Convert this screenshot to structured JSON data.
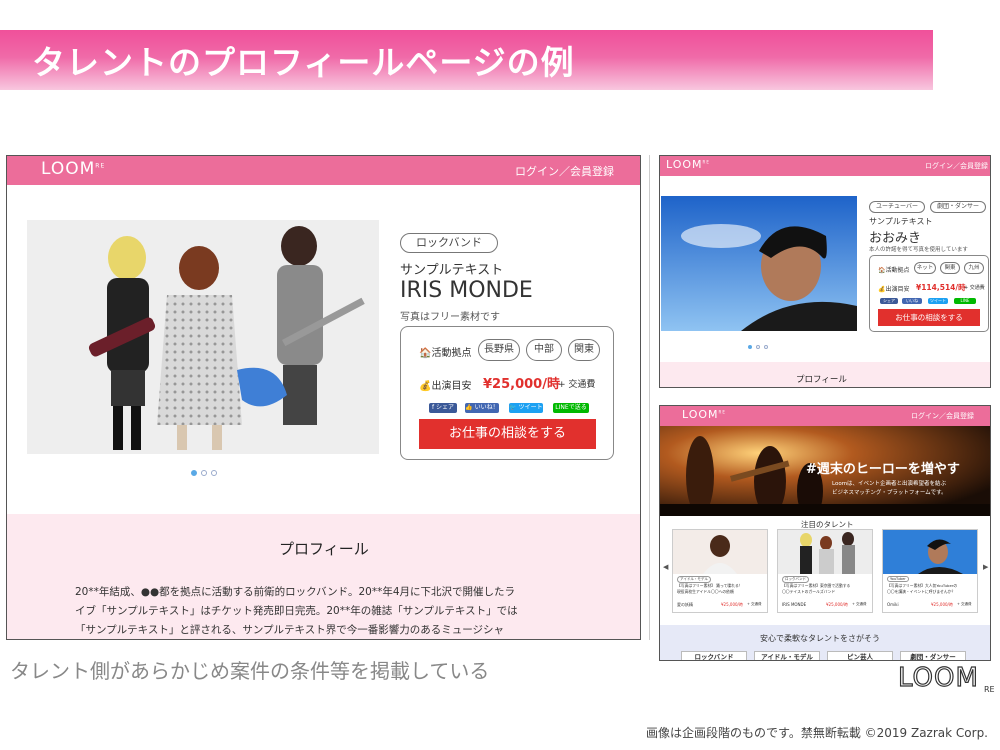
{
  "slide_title": "タレントのプロフィールページの例",
  "caption": "タレント側があらかじめ案件の条件等を掲載している",
  "copyright": "画像は企画段階のものです。禁無断転載 ©2019 Zazrak Corp.",
  "logo_text": "LOOM",
  "logo_sup": "RE",
  "main_page": {
    "login": "ログイン／会員登録",
    "category": "ロックバンド",
    "sample": "サンプルテキスト",
    "name": "IRIS MONDE",
    "photo_note": "写真はフリー素材です",
    "area_label": "🏠活動拠点",
    "areas": [
      "長野県",
      "中部",
      "関東"
    ],
    "fee_label": "💰出演目安",
    "fee": "¥25,000/時",
    "fee_suffix": "+ 交通費",
    "share": [
      "f シェア",
      "👍 いいね！",
      "🐦 ツイート",
      "LINEで送る"
    ],
    "cta": "お仕事の相談をする",
    "profile_heading": "プロフィール",
    "profile_lines": [
      "20**年結成、●●都を拠点に活動する前衛的ロックバンド。20**年4月に下北沢で開催したラ",
      "イブ「サンプルテキスト」はチケット発売即日完売。20**年の雑誌「サンプルテキスト」では",
      "「サンプルテキスト」と評される、サンプルテキスト界で今一番影響力のあるミュージシャ"
    ]
  },
  "mini_profile": {
    "login": "ログイン／会員登録",
    "categories": [
      "ユーチューバー",
      "劇団・ダンサー"
    ],
    "sample": "サンプルテキスト",
    "name": "おおみき",
    "note": "本人の許諾を得て写真を使用しています",
    "area_label": "🏠活動拠点",
    "areas": [
      "ネット",
      "関東",
      "九州"
    ],
    "fee_label": "💰出演目安",
    "fee": "¥114,514/時",
    "fee_suffix": "+ 交通費",
    "share": [
      "シェア",
      "いいね",
      "ツイート",
      "LINE"
    ],
    "cta": "お仕事の相談をする",
    "profile_heading": "プロフィール"
  },
  "mini_top": {
    "login": "ログイン／会員登録",
    "hero_title": "#週末のヒーローを増やす",
    "hero_sub_1": "Loomは、イベント企画者と出演希望者を結ぶ",
    "hero_sub_2": "ビジネスマッチング・プラットフォームです。",
    "featured_heading": "注目のタレント",
    "cards": [
      {
        "tag": "アイドル・モデル",
        "desc_1": "【写真はフリー素材】 踊って喋れる！",
        "desc_2": "現役高校生アイドル〇〇への依頼",
        "name": "愛の妖精",
        "fee": "¥25,000/時",
        "suffix": "+ 交通費"
      },
      {
        "tag": "ロックバンド",
        "desc_1": "【写真はフリー素材】東京圏で活動する",
        "desc_2": "〇〇テイストのガールズバンド",
        "name": "IRIS MONDE",
        "fee": "¥25,000/時",
        "suffix": "+ 交通費"
      },
      {
        "tag": "YouTuber",
        "desc_1": "【写真はフリー素材】大人気YouTuberの",
        "desc_2": "〇〇を講演・イベントに呼びませんか？",
        "name": "Omiki",
        "fee": "¥25,000/時",
        "suffix": "+ 交通費"
      }
    ],
    "search_heading": "安心で柔軟なタレントをさがそう",
    "search_categories": [
      "ロックバンド",
      "アイドル・モデル",
      "ピン芸人",
      "劇団・ダンサー"
    ]
  },
  "colors": {
    "brand_pink": "#ec6d9a",
    "cta_red": "#e1302d",
    "fee_red": "#e1302d",
    "profile_bg": "#fde9ef"
  }
}
